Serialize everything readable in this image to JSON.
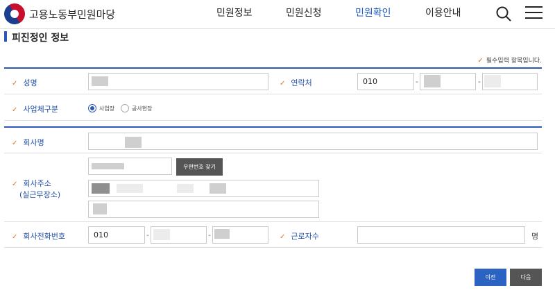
{
  "header": {
    "brand": "고용노동부민원마당",
    "nav": [
      "민원정보",
      "민원신청",
      "민원확인",
      "이용안내"
    ],
    "active_nav": "민원확인"
  },
  "page": {
    "title": "피진정인 정보",
    "required_note": "필수입력 항목입니다.",
    "check_mark": "✓"
  },
  "form": {
    "name_label": "성명",
    "contact_label": "연락처",
    "contact_prefix": "010",
    "business_type_label": "사업체구분",
    "business_type_options": [
      "사업장",
      "공사현장"
    ],
    "business_type_selected": "사업장",
    "company_label": "회사명",
    "address_label_line1": "회사주소",
    "address_label_line2": "(실근무장소)",
    "zip_button": "우편번호 찾기",
    "company_phone_label": "회사전화번호",
    "company_phone_prefix": "010",
    "workers_label": "근로자수",
    "workers_unit": "명",
    "dash": "-"
  },
  "actions": {
    "prev": "이전",
    "next": "다음"
  },
  "colors": {
    "accent": "#2b57b6",
    "check": "#e2711d",
    "label": "#1f4ea4"
  }
}
